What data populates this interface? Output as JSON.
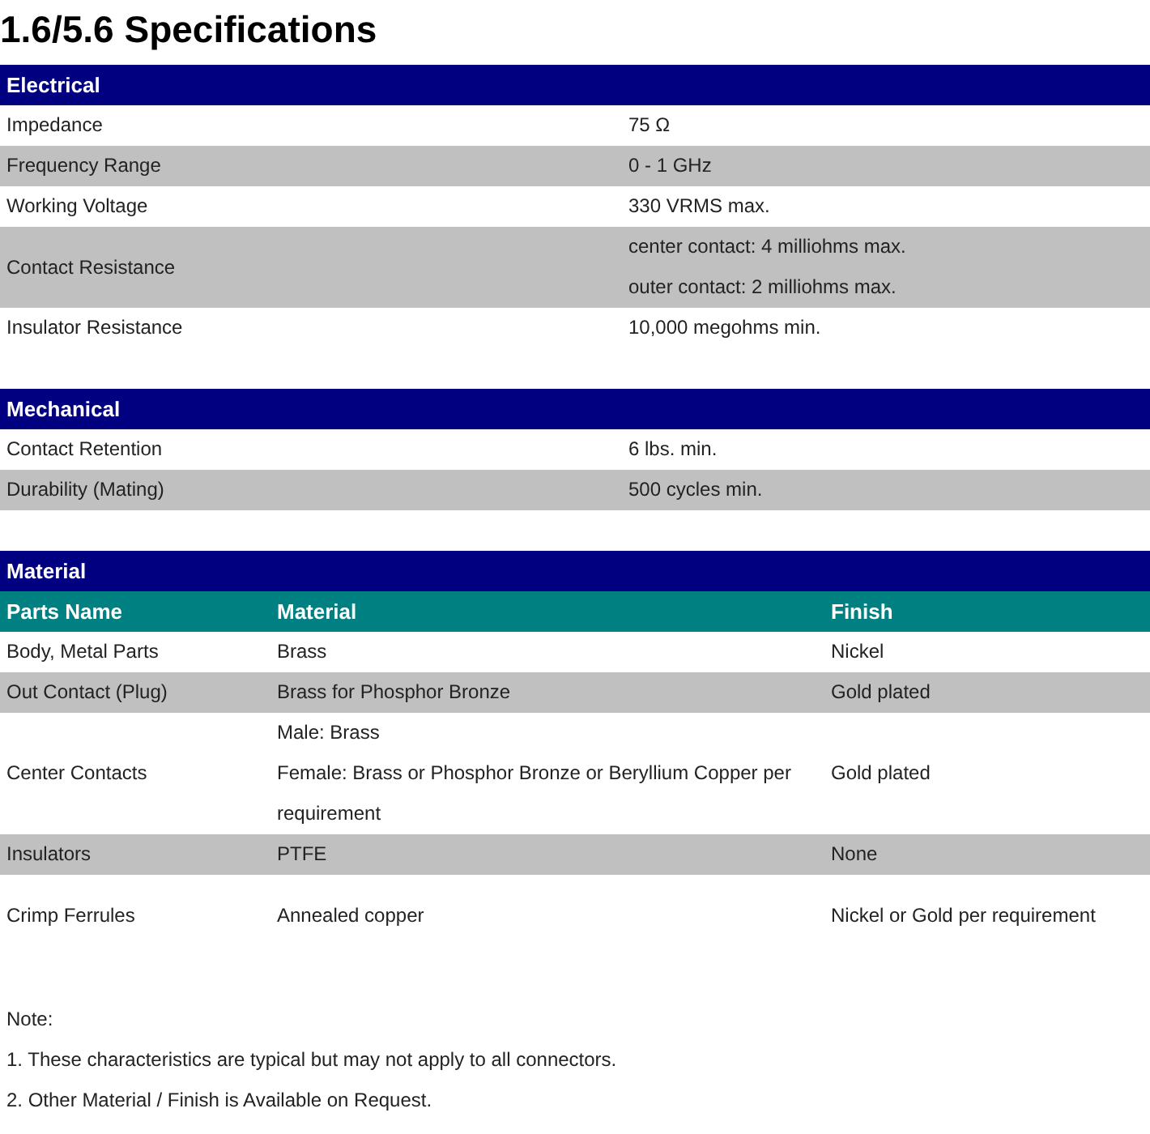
{
  "title": "1.6/5.6 Specifications",
  "sections": [
    {
      "kind": "pairs",
      "heading": "Electrical",
      "rows": [
        {
          "label": "Impedance",
          "lines": [
            "75 Ω"
          ]
        },
        {
          "label": "Frequency Range",
          "lines": [
            "0 - 1 GHz"
          ]
        },
        {
          "label": "Working Voltage",
          "lines": [
            "330 VRMS max."
          ]
        },
        {
          "label": "Contact Resistance",
          "lines": [
            "center contact: 4 milliohms max.",
            "outer contact: 2 milliohms max."
          ]
        },
        {
          "label": "Insulator Resistance",
          "lines": [
            "10,000 megohms min."
          ]
        }
      ]
    },
    {
      "kind": "pairs",
      "heading": "Mechanical",
      "rows": [
        {
          "label": "Contact Retention",
          "lines": [
            "6 lbs. min."
          ]
        },
        {
          "label": "Durability (Mating)",
          "lines": [
            "500 cycles min."
          ]
        }
      ]
    },
    {
      "kind": "table",
      "heading": "Material",
      "columns": [
        "Parts Name",
        "Material",
        "Finish"
      ],
      "rows": [
        [
          [
            "Body, Metal Parts"
          ],
          [
            "Brass"
          ],
          [
            "Nickel"
          ]
        ],
        [
          [
            "Out Contact (Plug)"
          ],
          [
            "Brass for Phosphor Bronze"
          ],
          [
            "Gold plated"
          ]
        ],
        [
          [
            "Center Contacts"
          ],
          [
            "Male: Brass",
            "Female: Brass or Phosphor Bronze or Beryllium Copper per requirement"
          ],
          [
            "Gold plated"
          ]
        ],
        [
          [
            "Insulators"
          ],
          [
            "PTFE"
          ],
          [
            "None"
          ]
        ],
        [
          [
            "Crimp Ferrules"
          ],
          [
            "Annealed copper"
          ],
          [
            "Nickel or Gold per requirement"
          ]
        ]
      ]
    }
  ],
  "notes": [
    "Note:",
    "1. These characteristics are typical but may not apply to all connectors.",
    "2. Other Material / Finish is Available on Request."
  ]
}
